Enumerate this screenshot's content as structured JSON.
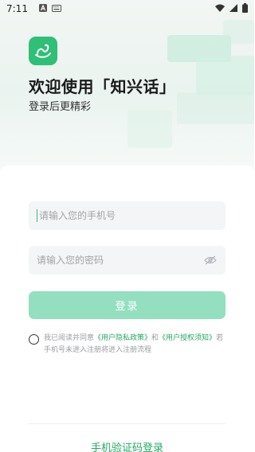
{
  "status_bar": {
    "time": "7:11"
  },
  "header": {
    "welcome": "欢迎使用「知兴话」",
    "subtitle": "登录后更精彩"
  },
  "form": {
    "phone_placeholder": "请输入您的手机号",
    "password_placeholder": "请输入您的密码",
    "login_label": "登录"
  },
  "agreement": {
    "prefix": "我已阅读并同意",
    "privacy_link": "《用户隐私政策》",
    "and": "和",
    "auth_link": "《用户授权须知》",
    "suffix": "若手机号未进入注册将进入注册流程"
  },
  "footer": {
    "sms_login": "手机验证码登录"
  },
  "colors": {
    "accent": "#2fbf77",
    "button_disabled": "#94dfc0",
    "link": "#25a864"
  }
}
